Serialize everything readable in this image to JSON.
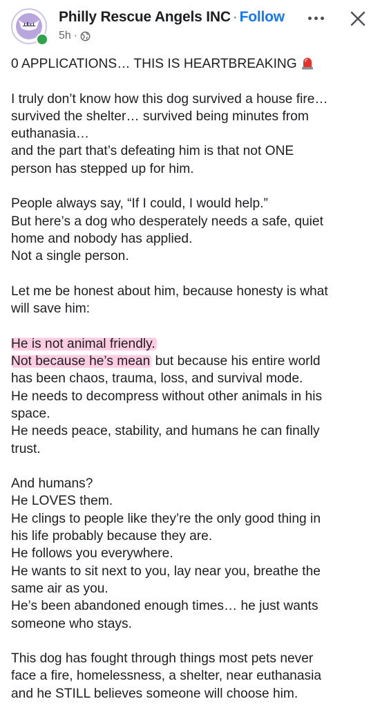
{
  "header": {
    "page_name": "Philly Rescue Angels INC",
    "separator": "·",
    "follow_label": "Follow",
    "time_ago": "5h",
    "meta_separator": "·",
    "privacy_icon": "globe-icon",
    "more_icon": "more-horizontal-icon",
    "close_icon": "close-icon"
  },
  "colors": {
    "link": "#1877f2",
    "text": "#1c1e21",
    "meta": "#65676b",
    "highlight": "#ffc4dd",
    "online": "#31a24c",
    "avatar": "#b9a6de"
  },
  "post": {
    "title": "0 APPLICATIONS… THIS IS HEARTBREAKING",
    "title_icon": "rotating-light-emoji",
    "p1": [
      "I truly don’t know how this dog survived a house fire…",
      "survived the shelter… survived being minutes from",
      "euthanasia…",
      "and the part that’s defeating him is that not ONE",
      "person has stepped up for him."
    ],
    "p2": [
      "People always say, “If I could, I would help.”",
      "But here’s a dog who desperately needs a safe, quiet",
      "home and nobody has applied.",
      "Not a single person."
    ],
    "p3": [
      "Let me be honest about him, because honesty is what",
      "will save him:"
    ],
    "p4": {
      "line1_highlight": "He is not animal friendly.",
      "line2_highlight": "Not because he’s mean",
      "line2_rest": " but because his entire world",
      "lines": [
        "has been chaos, trauma, loss, and survival mode.",
        "He needs to decompress without other animals in his",
        "space.",
        "He needs peace, stability, and humans he can finally",
        "trust."
      ]
    },
    "p5": [
      "And humans?",
      "He LOVES them.",
      "He clings to people like they’re the only good thing in",
      "his life probably because they are.",
      "He follows you everywhere.",
      "He wants to sit next to you, lay near you, breathe the",
      "same air as you.",
      "He’s been abandoned enough times… he just wants",
      "someone who stays."
    ],
    "p6": [
      "This dog has fought through things most pets never",
      "face a fire, homelessness, a shelter, near euthanasia",
      "and he STILL believes someone will choose him."
    ]
  }
}
